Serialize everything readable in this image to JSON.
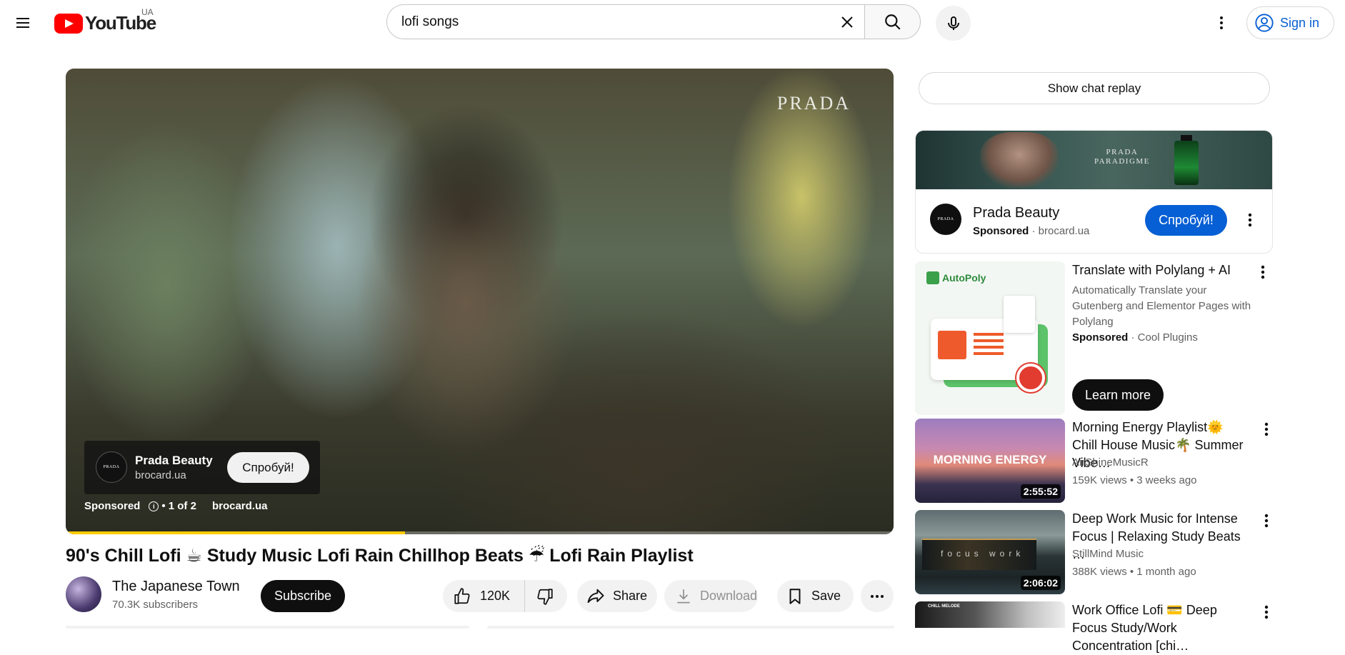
{
  "header": {
    "logo_text": "YouTube",
    "country": "UA",
    "search_value": "lofi songs",
    "signin_label": "Sign in"
  },
  "player": {
    "brand_watermark": "PRADA",
    "progress_fraction": 0.41,
    "ad_card": {
      "name": "Prada Beauty",
      "url": "brocard.ua",
      "cta": "Спробуй!",
      "avatar_text": "PRADA"
    },
    "ad_status": {
      "sponsored": "Sponsored",
      "info_glyph": "i",
      "count": "• 1 of 2",
      "url": "brocard.ua"
    }
  },
  "video": {
    "title": "90's Chill Lofi ☕ Study Music Lofi Rain Chillhop Beats ☔ Lofi Rain Playlist",
    "channel": {
      "name": "The Japanese Town",
      "subscribers": "70.3K subscribers"
    },
    "subscribe_label": "Subscribe",
    "actions": {
      "likes": "120K",
      "share": "Share",
      "download": "Download",
      "save": "Save"
    }
  },
  "sidebar": {
    "chat_replay": "Show chat replay",
    "ad": {
      "banner_brand": "PRADA\nPARADIGME",
      "avatar_text": "PRADA",
      "name": "Prada Beauty",
      "sponsored": "Sponsored",
      "domain": "· brocard.ua",
      "cta": "Спробуй!"
    },
    "promo": {
      "thumb_label": "AutoPoly",
      "title": "Translate with Polylang + AI",
      "description": "Automatically Translate your Gutenberg and Elementor Pages with Polylang",
      "sponsored": "Sponsored",
      "advertiser": "· Cool Plugins",
      "cta": "Learn more"
    },
    "recommendations": [
      {
        "title": "Morning Energy Playlist🌞 Chill House Music🌴 Summer Vibe…",
        "channel": "AirShineMusicR",
        "meta": "159K views • 3 weeks ago",
        "duration": "2:55:52",
        "thumb_text": "MORNING ENERGY"
      },
      {
        "title": "Deep Work Music for Intense Focus | Relaxing Study Beats …",
        "channel": "StillMind Music",
        "meta": "388K views • 1 month ago",
        "duration": "2:06:02",
        "thumb_text": "focus work"
      },
      {
        "title": "Work Office Lofi 💳 Deep Focus Study/Work Concentration [chi…",
        "thumb_text": "CHILL MELODE"
      }
    ]
  },
  "colors": {
    "brand_red": "#ff0000",
    "signin_blue": "#065fd4",
    "ad_progress": "#ffcc00"
  },
  "icons": [
    "menu-icon",
    "youtube-logo-icon",
    "clear-icon",
    "search-icon",
    "mic-icon",
    "more-vert-icon",
    "account-icon",
    "like-icon",
    "dislike-icon",
    "share-icon",
    "download-icon",
    "save-icon",
    "more-horiz-icon",
    "info-icon"
  ]
}
